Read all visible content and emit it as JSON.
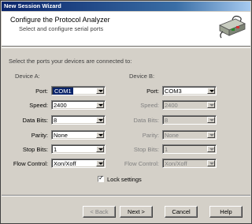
{
  "window": {
    "title": "New Session Wizard"
  },
  "header": {
    "title": "Configure the Protocol Analyzer",
    "subtitle": "Select and configure serial ports",
    "icon": "serial-device-icon"
  },
  "instruction": "Select the ports your devices are connected to:",
  "device_a": {
    "label": "Device A:",
    "fields": [
      {
        "label": "Port:",
        "value": "COM1"
      },
      {
        "label": "Speed:",
        "value": "2400"
      },
      {
        "label": "Data Bits:",
        "value": "8"
      },
      {
        "label": "Parity:",
        "value": "None"
      },
      {
        "label": "Stop Bits:",
        "value": "1"
      },
      {
        "label": "Flow Control:",
        "value": "Xon/Xoff"
      }
    ]
  },
  "device_b": {
    "label": "Device B:",
    "fields": [
      {
        "label": "Port:",
        "value": "COM3"
      },
      {
        "label": "Speed:",
        "value": "2400"
      },
      {
        "label": "Data Bits:",
        "value": "8"
      },
      {
        "label": "Parity:",
        "value": "None"
      },
      {
        "label": "Stop Bits:",
        "value": "1"
      },
      {
        "label": "Flow Control:",
        "value": "Xon/Xoff"
      }
    ]
  },
  "lock_settings": {
    "label": "Lock settings",
    "checked": true
  },
  "buttons": {
    "back": "< Back",
    "next": "Next >",
    "cancel": "Cancel",
    "help": "Help"
  }
}
